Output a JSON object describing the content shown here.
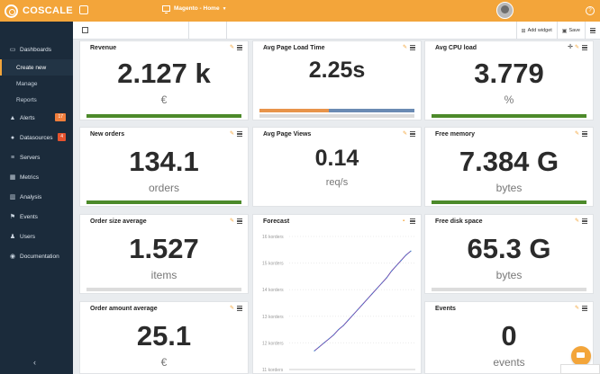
{
  "app": {
    "logo_text": "COSCALE",
    "dashboard_selector": "Magento - Home"
  },
  "sidebar": {
    "items": [
      {
        "label": "Dashboards",
        "icon": "monitor-icon"
      },
      {
        "label": "Create new"
      },
      {
        "label": "Manage"
      },
      {
        "label": "Reports"
      },
      {
        "label": "Alerts",
        "icon": "alert-icon",
        "badge": "17",
        "badge_color": "#f07e3c"
      },
      {
        "label": "Datasources",
        "icon": "globe-icon",
        "badge": "4",
        "badge_color": "#e6532e"
      },
      {
        "label": "Servers",
        "icon": "servers-icon"
      },
      {
        "label": "Metrics",
        "icon": "metrics-icon"
      },
      {
        "label": "Analysis",
        "icon": "chart-icon"
      },
      {
        "label": "Events",
        "icon": "events-icon"
      },
      {
        "label": "Users",
        "icon": "users-icon"
      },
      {
        "label": "Documentation",
        "icon": "documentation-icon"
      }
    ],
    "collapse_icon": "chevron-left-icon"
  },
  "toolbar": {
    "add_widget_label": "Add widget",
    "save_label": "Save"
  },
  "widgets": {
    "revenue": {
      "title": "Revenue",
      "value": "2.127 k",
      "unit": "€",
      "progress": 1.0
    },
    "avg_page_load_time": {
      "title": "Avg Page Load Time",
      "value": "2.25s",
      "segments": [
        {
          "fraction": 0.45,
          "color": "#e8944a"
        },
        {
          "fraction": 0.55,
          "color": "#6b8bb3"
        }
      ]
    },
    "avg_cpu_load": {
      "title": "Avg CPU load",
      "value": "3.779",
      "unit": "%",
      "progress": 1.0
    },
    "new_orders": {
      "title": "New orders",
      "value": "134.1",
      "unit": "orders",
      "progress": 1.0
    },
    "avg_page_views": {
      "title": "Avg Page Views",
      "value": "0.14",
      "unit": "req/s"
    },
    "free_memory": {
      "title": "Free memory",
      "value": "7.384 G",
      "unit": "bytes",
      "progress": 1.0
    },
    "order_size_average": {
      "title": "Order size average",
      "value": "1.527",
      "unit": "items",
      "progress": 0.0
    },
    "forecast": {
      "title": "Forecast"
    },
    "free_disk_space": {
      "title": "Free disk space",
      "value": "65.3 G",
      "unit": "bytes",
      "progress": 0.0
    },
    "order_amount_average": {
      "title": "Order amount average",
      "value": "25.1",
      "unit": "€"
    },
    "events": {
      "title": "Events",
      "value": "0",
      "unit": "events"
    }
  },
  "colors": {
    "brand_orange": "#f3a53a",
    "sidebar_bg": "#1b2b3b",
    "progress_green": "#4c8a2a",
    "forecast_line": "#6a4fb0"
  },
  "chart_data": {
    "type": "line",
    "title": "Forecast",
    "ytick_labels": [
      "16 korders",
      "15 korders",
      "14 korders",
      "13 korders",
      "12 korders",
      "11 korders"
    ],
    "ylim": [
      11,
      16
    ],
    "series": [
      {
        "x": [
          0,
          1,
          2,
          3,
          4,
          5,
          6,
          7,
          8,
          9,
          10,
          11,
          12,
          13,
          14,
          15,
          16,
          17,
          18,
          19,
          20
        ],
        "values": [
          11.7,
          11.85,
          12.0,
          12.15,
          12.3,
          12.5,
          12.65,
          12.85,
          13.05,
          13.25,
          13.45,
          13.65,
          13.85,
          14.05,
          14.25,
          14.45,
          14.7,
          14.9,
          15.1,
          15.3,
          15.45
        ]
      }
    ]
  }
}
